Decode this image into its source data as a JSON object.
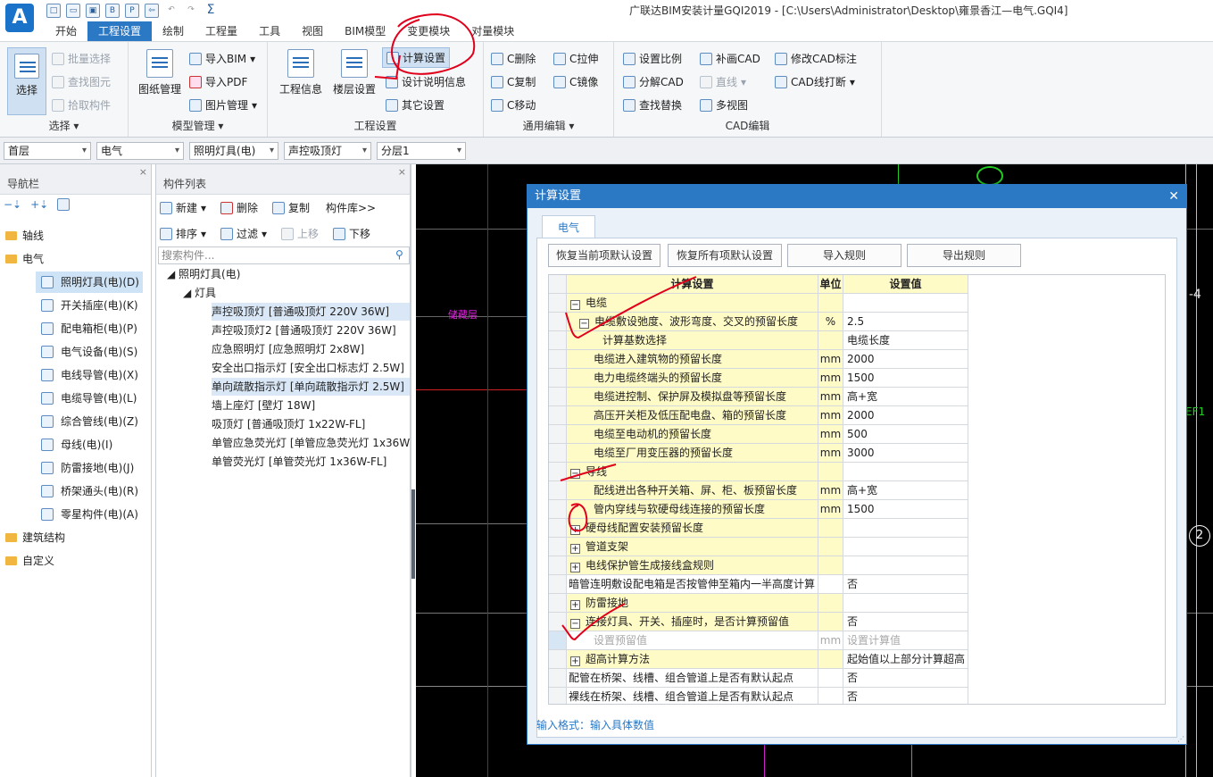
{
  "app": {
    "logo": "A",
    "window_title": "广联达BIM安装计量GQI2019 - [C:\\Users\\Administrator\\Desktop\\雍景香江—电气.GQI4]"
  },
  "menu": [
    "开始",
    "工程设置",
    "绘制",
    "工程量",
    "工具",
    "视图",
    "BIM模型",
    "变更模块",
    "对量模块"
  ],
  "ribbon": {
    "select_group": {
      "label": "选择",
      "select": "选择",
      "batch": "批量选择",
      "find": "查找图元",
      "pick": "拾取构件"
    },
    "model_group": {
      "label": "模型管理",
      "drawing": "图纸管理",
      "import_bim": "导入BIM",
      "import_pdf": "导入PDF",
      "picture": "图片管理"
    },
    "project_group": {
      "label": "工程设置",
      "info": "工程信息",
      "floor": "楼层设置",
      "calc": "计算设置",
      "design": "设计说明信息",
      "other": "其它设置"
    },
    "edit_group": {
      "label": "通用编辑",
      "delete": "C删除",
      "copy": "C复制",
      "move": "C移动",
      "stretch": "C拉伸",
      "mirror": "C镜像"
    },
    "cad_group": {
      "label": "CAD编辑",
      "scale": "设置比例",
      "explode": "分解CAD",
      "findrep": "查找替换",
      "redraw": "补画CAD",
      "line": "直线",
      "multiview": "多视图",
      "modify": "修改CAD标注",
      "break": "CAD线打断"
    }
  },
  "selectors": [
    "首层",
    "电气",
    "照明灯具(电)",
    "声控吸顶灯",
    "分层1"
  ],
  "nav": {
    "title": "导航栏",
    "items": [
      {
        "label": "轴线",
        "type": "folder"
      },
      {
        "label": "电气",
        "type": "folder"
      },
      {
        "label": "照明灯具(电)(D)",
        "type": "item",
        "selected": true
      },
      {
        "label": "开关插座(电)(K)",
        "type": "item"
      },
      {
        "label": "配电箱柜(电)(P)",
        "type": "item"
      },
      {
        "label": "电气设备(电)(S)",
        "type": "item"
      },
      {
        "label": "电线导管(电)(X)",
        "type": "item"
      },
      {
        "label": "电缆导管(电)(L)",
        "type": "item"
      },
      {
        "label": "综合管线(电)(Z)",
        "type": "item"
      },
      {
        "label": "母线(电)(I)",
        "type": "item"
      },
      {
        "label": "防雷接地(电)(J)",
        "type": "item"
      },
      {
        "label": "桥架通头(电)(R)",
        "type": "item"
      },
      {
        "label": "零星构件(电)(A)",
        "type": "item"
      },
      {
        "label": "建筑结构",
        "type": "folder"
      },
      {
        "label": "自定义",
        "type": "folder"
      }
    ]
  },
  "complist": {
    "title": "构件列表",
    "new": "新建",
    "delete": "删除",
    "copy": "复制",
    "lib": "构件库>>",
    "sort": "排序",
    "filter": "过滤",
    "up": "上移",
    "down": "下移",
    "search_placeholder": "搜索构件...",
    "root": "照明灯具(电)",
    "group": "灯具",
    "items": [
      {
        "label": "声控吸顶灯 [普通吸顶灯 220V 36W]",
        "hl": true
      },
      {
        "label": "声控吸顶灯2 [普通吸顶灯 220V 36W]"
      },
      {
        "label": "应急照明灯 [应急照明灯 2x8W]"
      },
      {
        "label": "安全出口指示灯 [安全出口标志灯 2.5W]"
      },
      {
        "label": "单向疏散指示灯 [单向疏散指示灯 2.5W]",
        "hl": true
      },
      {
        "label": "墙上座灯 [壁灯 18W]"
      },
      {
        "label": "吸顶灯 [普通吸顶灯 1x22W-FL]"
      },
      {
        "label": "单管应急荧光灯 [单管应急荧光灯 1x36W"
      },
      {
        "label": "单管荧光灯 [单管荧光灯 1x36W-FL]"
      }
    ]
  },
  "cad": {
    "room_label": "储藏层",
    "right_text_1": "-4",
    "right_text_2": "EF1",
    "circle_num": "2"
  },
  "dialog": {
    "title": "计算设置",
    "tab": "电气",
    "buttons": [
      "恢复当前项默认设置",
      "恢复所有项默认设置",
      "导入规则",
      "导出规则"
    ],
    "headers": [
      "计算设置",
      "单位",
      "设置值"
    ],
    "rows": [
      {
        "level": 0,
        "pm": "−",
        "name": "电缆",
        "unit": "",
        "value": ""
      },
      {
        "level": 1,
        "pm": "−",
        "name": "电缆敷设弛度、波形弯度、交叉的预留长度",
        "unit": "%",
        "value": "2.5"
      },
      {
        "level": 2,
        "pm": "",
        "name": "计算基数选择",
        "unit": "",
        "value": "电缆长度"
      },
      {
        "level": 2,
        "pm": "",
        "name": "电缆进入建筑物的预留长度",
        "unit": "mm",
        "value": "2000"
      },
      {
        "level": 2,
        "pm": "",
        "name": "电力电缆终端头的预留长度",
        "unit": "mm",
        "value": "1500"
      },
      {
        "level": 2,
        "pm": "",
        "name": "电缆进控制、保护屏及模拟盘等预留长度",
        "unit": "mm",
        "value": "高+宽"
      },
      {
        "level": 2,
        "pm": "",
        "name": "高压开关柜及低压配电盘、箱的预留长度",
        "unit": "mm",
        "value": "2000"
      },
      {
        "level": 2,
        "pm": "",
        "name": "电缆至电动机的预留长度",
        "unit": "mm",
        "value": "500"
      },
      {
        "level": 2,
        "pm": "",
        "name": "电缆至厂用变压器的预留长度",
        "unit": "mm",
        "value": "3000"
      },
      {
        "level": 0,
        "pm": "−",
        "name": "导线",
        "unit": "",
        "value": ""
      },
      {
        "level": 2,
        "pm": "",
        "name": "配线进出各种开关箱、屏、柜、板预留长度",
        "unit": "mm",
        "value": "高+宽"
      },
      {
        "level": 2,
        "pm": "",
        "name": "管内穿线与软硬母线连接的预留长度",
        "unit": "mm",
        "value": "1500"
      },
      {
        "level": 0,
        "pm": "+",
        "name": "硬母线配置安装预留长度",
        "unit": "",
        "value": ""
      },
      {
        "level": 0,
        "pm": "+",
        "name": "管道支架",
        "unit": "",
        "value": ""
      },
      {
        "level": 0,
        "pm": "+",
        "name": "电线保护管生成接线盒规则",
        "unit": "",
        "value": ""
      },
      {
        "level": -1,
        "pm": "",
        "name": "暗管连明敷设配电箱是否按管伸至箱内一半高度计算",
        "unit": "",
        "value": "否"
      },
      {
        "level": 0,
        "pm": "+",
        "name": "防雷接地",
        "unit": "",
        "value": ""
      },
      {
        "level": 0,
        "pm": "−",
        "name": "连接灯具、开关、插座时，是否计算预留值",
        "unit": "",
        "value": "否"
      },
      {
        "level": 2,
        "pm": "",
        "name": "设置预留值",
        "unit": "mm",
        "value": "设置计算值",
        "dim": true
      },
      {
        "level": 0,
        "pm": "+",
        "name": "超高计算方法",
        "unit": "",
        "value": "起始值以上部分计算超高"
      },
      {
        "level": -1,
        "pm": "",
        "name": "配管在桥架、线槽、组合管道上是否有默认起点",
        "unit": "",
        "value": "否"
      },
      {
        "level": -1,
        "pm": "",
        "name": "裸线在桥架、线槽、组合管道上是否有默认起点",
        "unit": "",
        "value": "否"
      }
    ],
    "format_hint": "输入格式：输入具体数值"
  },
  "colors": {
    "accent": "#2b78c5",
    "grid_yellow": "#fffbc6",
    "annotation": "#e0001b"
  }
}
